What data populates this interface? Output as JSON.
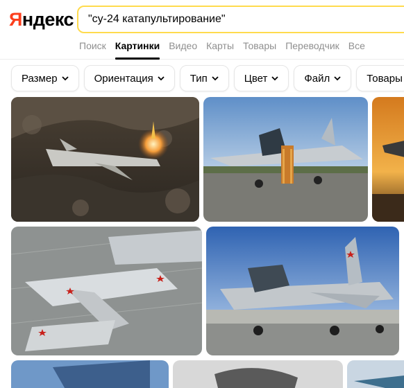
{
  "logo": {
    "first_letter": "Я",
    "rest": "ндекс"
  },
  "search": {
    "query": "\"су-24 катапультирование\""
  },
  "tabs": [
    {
      "label": "Поиск",
      "active": false
    },
    {
      "label": "Картинки",
      "active": true
    },
    {
      "label": "Видео",
      "active": false
    },
    {
      "label": "Карты",
      "active": false
    },
    {
      "label": "Товары",
      "active": false
    },
    {
      "label": "Переводчик",
      "active": false
    },
    {
      "label": "Все",
      "active": false
    }
  ],
  "filters": [
    {
      "label": "Размер"
    },
    {
      "label": "Ориентация"
    },
    {
      "label": "Тип"
    },
    {
      "label": "Цвет"
    },
    {
      "label": "Файл"
    },
    {
      "label": "Товары"
    }
  ],
  "images": [
    {
      "name": "su24-ejection-forest"
    },
    {
      "name": "su24-ladder-airfield"
    },
    {
      "name": "su24-sunset-partial"
    },
    {
      "name": "su24-parked-row"
    },
    {
      "name": "su24-taxiing-airfield"
    },
    {
      "name": "bottom-blue-jet"
    },
    {
      "name": "bottom-cockpit-bw"
    },
    {
      "name": "bottom-partial-jet"
    }
  ],
  "colors": {
    "brand_red": "#fc3f1d",
    "search_border": "#ffdb4d",
    "tab_gray": "#8f8f8f"
  }
}
